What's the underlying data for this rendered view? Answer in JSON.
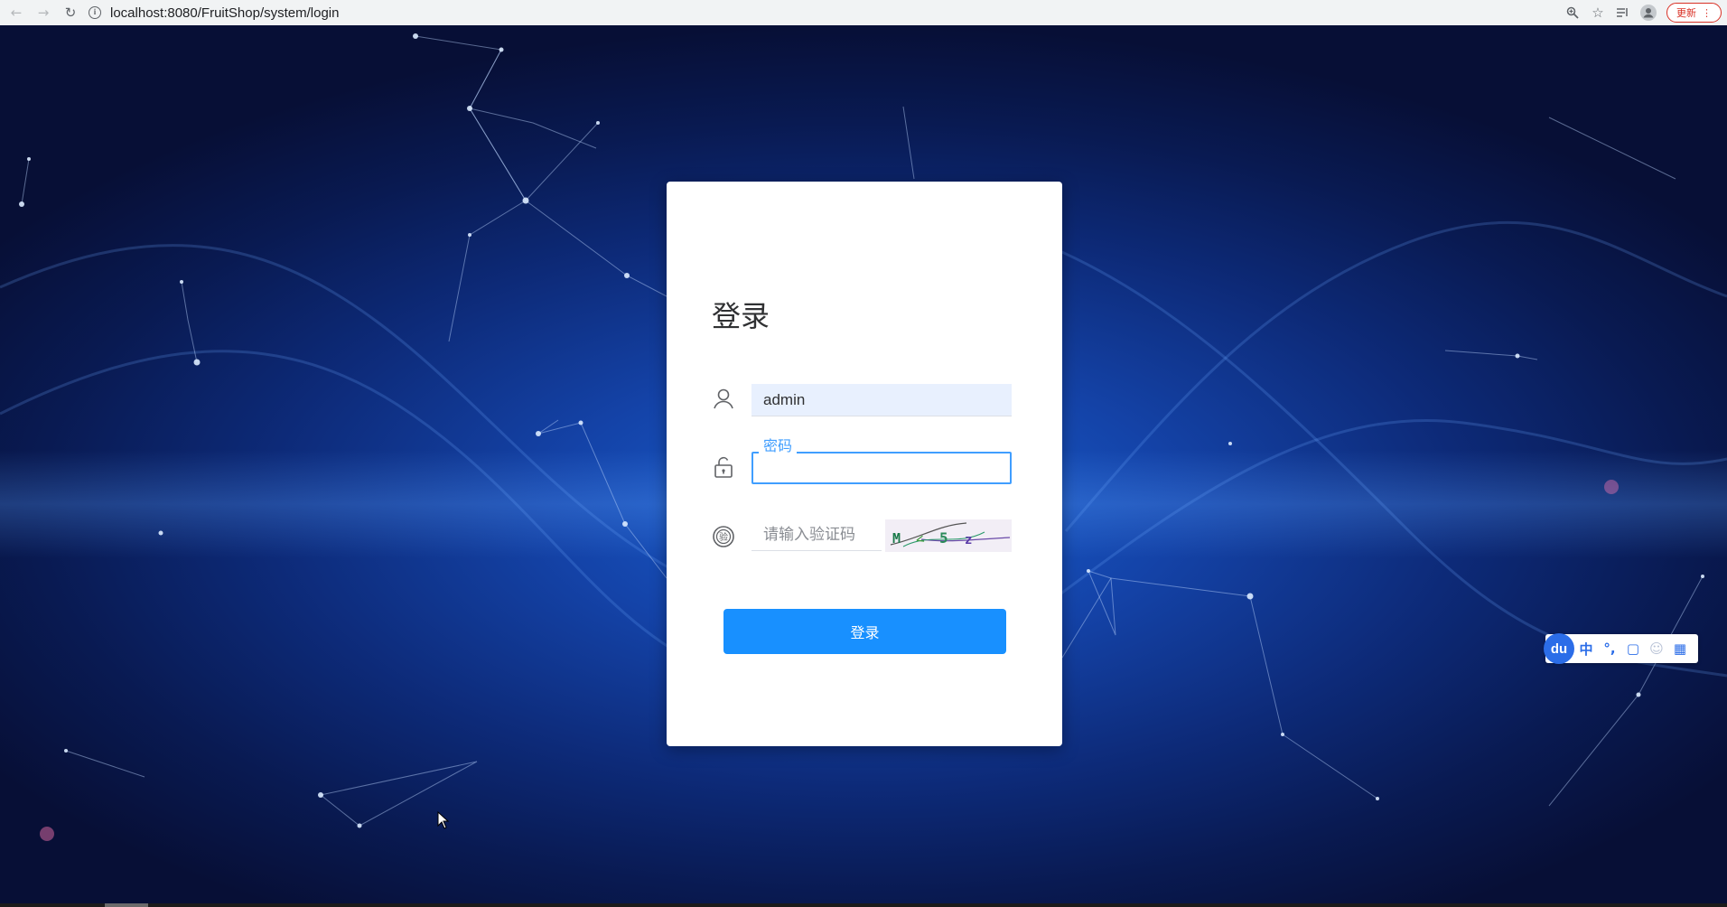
{
  "browser": {
    "url": "localhost:8080/FruitShop/system/login",
    "update_label": "更新",
    "icons": [
      "back-icon",
      "forward-icon",
      "reload-icon",
      "info-icon",
      "zoom-icon",
      "star-icon",
      "reading-list-icon",
      "profile-icon",
      "menu-icon"
    ]
  },
  "login": {
    "title": "登录",
    "username": {
      "value": "admin"
    },
    "password": {
      "label": "密码",
      "value": ""
    },
    "captcha": {
      "placeholder": "请输入验证码",
      "image_text": "M<5z"
    },
    "submit_label": "登录"
  },
  "ime": {
    "logo": "du",
    "items": [
      "中",
      "°,",
      "▢",
      "☺",
      "▦"
    ]
  },
  "colors": {
    "accent": "#1890ff",
    "focus": "#409eff",
    "card": "#ffffff",
    "background": "#0d2a78"
  }
}
